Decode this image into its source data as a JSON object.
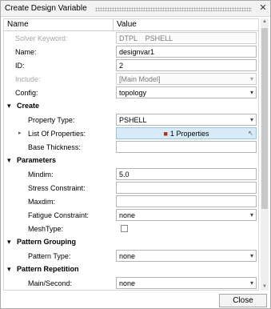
{
  "window": {
    "title": "Create Design Variable"
  },
  "icons": {
    "close": "close-icon",
    "property_collection": "properties-icon",
    "pointer": "pointer-icon"
  },
  "columns": {
    "name": "Name",
    "value": "Value"
  },
  "fields": {
    "solver_keyword": {
      "label": "Solver Keyword:",
      "value": "DTPL    PSHELL"
    },
    "name": {
      "label": "Name:",
      "value": "designvar1"
    },
    "id": {
      "label": "ID:",
      "value": "2"
    },
    "include": {
      "label": "Include:",
      "value": "[Main Model]"
    },
    "config": {
      "label": "Config:",
      "value": "topology"
    }
  },
  "sections": {
    "create": {
      "title": "Create",
      "property_type": {
        "label": "Property Type:",
        "value": "PSHELL"
      },
      "list_of_properties": {
        "label": "List Of Properties:",
        "value": "1 Properties"
      },
      "base_thickness": {
        "label": "Base Thickness:",
        "value": ""
      }
    },
    "parameters": {
      "title": "Parameters",
      "mindim": {
        "label": "Mindim:",
        "value": "5.0"
      },
      "stress_constraint": {
        "label": "Stress Constraint:",
        "value": ""
      },
      "maxdim": {
        "label": "Maxdim:",
        "value": ""
      },
      "fatigue_constraint": {
        "label": "Fatigue Constraint:",
        "value": "none"
      },
      "meshtype": {
        "label": "MeshType:",
        "checked": false
      }
    },
    "pattern_grouping": {
      "title": "Pattern Grouping",
      "pattern_type": {
        "label": "Pattern Type:",
        "value": "none"
      }
    },
    "pattern_repetition": {
      "title": "Pattern Repetition",
      "main_second": {
        "label": "Main/Second:",
        "value": "none"
      }
    }
  },
  "buttons": {
    "close": "Close"
  }
}
